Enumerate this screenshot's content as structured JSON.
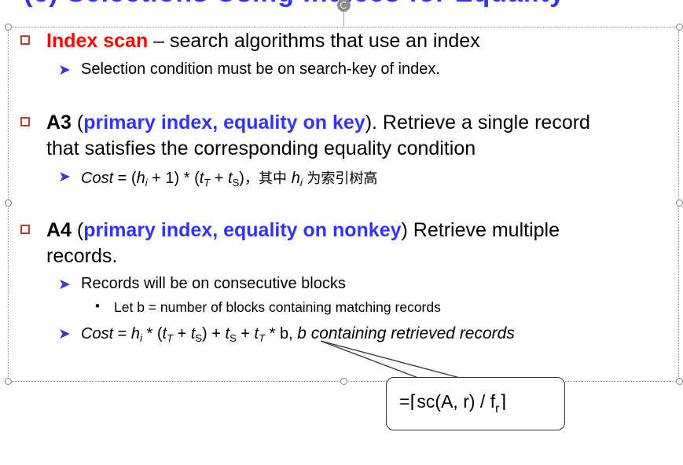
{
  "slide": {
    "title_partial": "(c) Selections Using Indices for Equality"
  },
  "index_scan": {
    "term": "Index scan",
    "desc": " – search algorithms that use an index",
    "sub": "Selection condition must be on search-key of index."
  },
  "a3": {
    "label": "A3",
    "open": " (",
    "qualifier": "primary index, equality on key",
    "rest1": ").  Retrieve a single record",
    "rest2": "that satisfies the corresponding equality condition",
    "cost": {
      "cost_word": "Cost",
      "eq": " = (",
      "h": "h",
      "i": "i",
      "plus1": " + 1) * (",
      "t1": "t",
      "T": "T",
      "plus": " + ",
      "t2": "t",
      "S": "S",
      "close": ")",
      "cjk_pre": "，其中 ",
      "h2": "h",
      "i2": "i",
      "cjk_post": " 为索引树高"
    }
  },
  "a4": {
    "label": "A4",
    "open": " (",
    "qualifier": "primary index, equality on nonkey",
    "rest1": ") Retrieve multiple",
    "rest2": "records.",
    "sub1": "Records will be on consecutive blocks",
    "subsub": "Let b = number of blocks containing matching records",
    "cost": {
      "cost_word": "Cost",
      "eq": " = ",
      "h": "h",
      "i": "i",
      "mul": " * (",
      "t1": "t",
      "T1": "T",
      "plus1": " + ",
      "t2": "t",
      "S1": "S",
      "close": ") + ",
      "t3": "t",
      "S2": "S",
      "plus2": " + ",
      "t4": "t",
      "T2": "T",
      "tail": " * b, ",
      "italic_tail": "b containing retrieved records"
    }
  },
  "callout": {
    "prefix": "=",
    "lceil": "⌈",
    "expr": "sc(A, r) / f",
    "sub": "r",
    "rceil": "⌉"
  },
  "colors": {
    "red": "#ff0000",
    "blue": "#3333ff",
    "bullet": "#c0392b"
  }
}
